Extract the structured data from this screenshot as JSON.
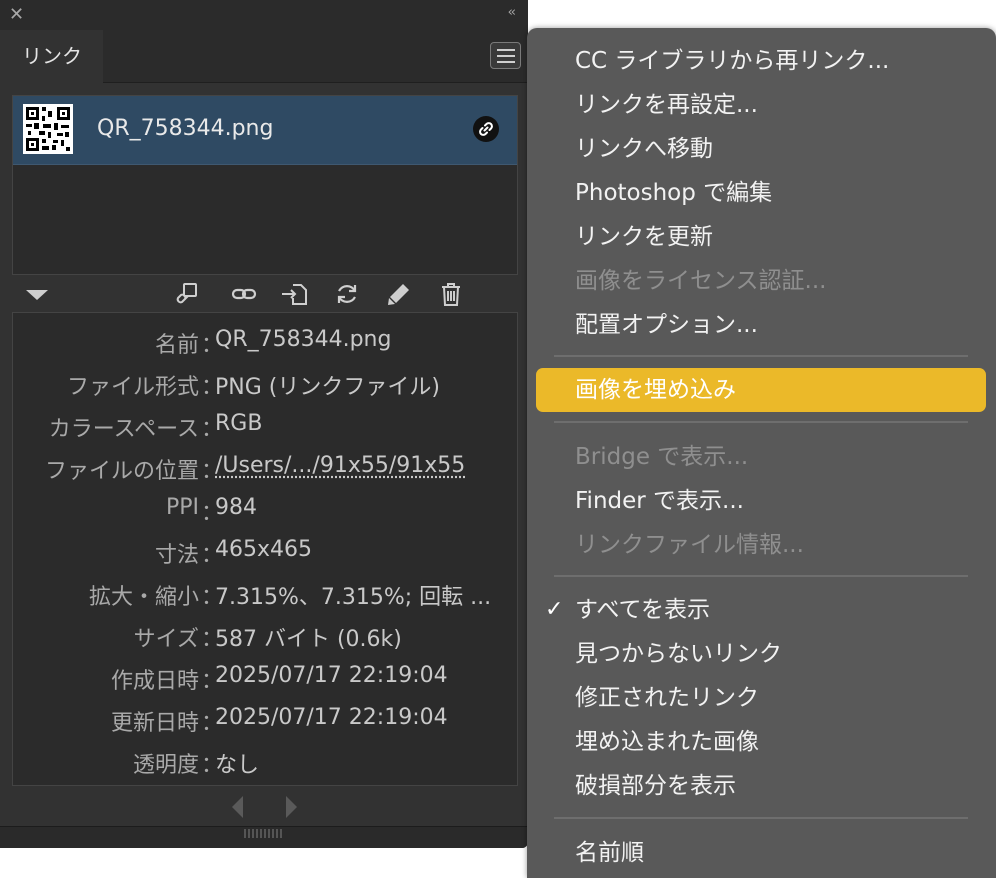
{
  "panel": {
    "tab_label": "リンク",
    "link": {
      "file_name": "QR_758344.png",
      "thumbnail": "qr-code-thumbnail",
      "badge_icon": "link-icon"
    },
    "toolbar_icons": [
      "relink-from-cc-library-icon",
      "relink-icon",
      "go-to-link-icon",
      "update-link-icon",
      "edit-original-icon",
      "delete-icon"
    ],
    "info": [
      {
        "key": "名前",
        "value": "QR_758344.png"
      },
      {
        "key": "ファイル形式",
        "value": "PNG (リンクファイル)"
      },
      {
        "key": "カラースペース",
        "value": "RGB"
      },
      {
        "key": "ファイルの位置",
        "value": "/Users/.../91x55/91x55"
      },
      {
        "key": "PPI",
        "value": "984"
      },
      {
        "key": "寸法",
        "value": "465x465"
      },
      {
        "key": "拡大・縮小",
        "value": "7.315%、7.315%; 回転 ..."
      },
      {
        "key": "サイズ",
        "value": "587 バイト (0.6k)"
      },
      {
        "key": "作成日時",
        "value": "2025/07/17 22:19:04"
      },
      {
        "key": "更新日時",
        "value": "2025/07/17 22:19:04"
      },
      {
        "key": "透明度",
        "value": "なし"
      }
    ],
    "separator": "："
  },
  "menu": {
    "items": [
      {
        "label": "CC ライブラリから再リンク...",
        "enabled": true
      },
      {
        "label": "リンクを再設定...",
        "enabled": true
      },
      {
        "label": "リンクへ移動",
        "enabled": true
      },
      {
        "label": "Photoshop で編集",
        "enabled": true
      },
      {
        "label": "リンクを更新",
        "enabled": true
      },
      {
        "label": "画像をライセンス認証...",
        "enabled": false
      },
      {
        "label": "配置オプション...",
        "enabled": true
      },
      {
        "label": "画像を埋め込み",
        "enabled": true,
        "highlighted": true
      },
      {
        "label": "Bridge で表示...",
        "enabled": false
      },
      {
        "label": "Finder で表示...",
        "enabled": true
      },
      {
        "label": "リンクファイル情報...",
        "enabled": false
      },
      {
        "label": "すべてを表示",
        "enabled": true,
        "checked": true
      },
      {
        "label": "見つからないリンク",
        "enabled": true
      },
      {
        "label": "修正されたリンク",
        "enabled": true
      },
      {
        "label": "埋め込まれた画像",
        "enabled": true
      },
      {
        "label": "破損部分を表示",
        "enabled": true
      },
      {
        "label": "名前順",
        "enabled": true
      }
    ],
    "check_mark": "✓",
    "highlight_color": "#ebb929"
  }
}
